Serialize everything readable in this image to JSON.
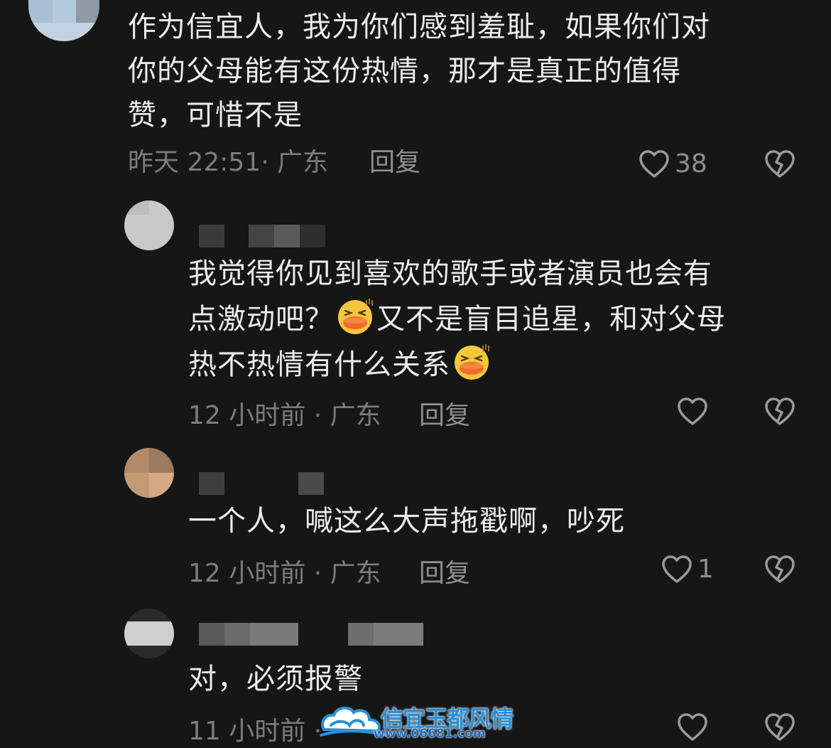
{
  "comments": [
    {
      "text": "作为信宜人，我为你们感到羞耻，如果你们对\n你的父母能有这份热情，那才是真正的值得\n赞，可惜不是",
      "time": "昨天 22:51·",
      "location": "广东",
      "reply_label": "回复",
      "likes": "38"
    },
    {
      "text_part1": "我觉得你见到喜欢的歌手或者演员也会有\n点激动吧？",
      "text_part2": "又不是盲目追星，和对父母\n热不热情有什么关系",
      "emoji": "duck-face-emoji",
      "time": "12 小时前 ·",
      "location": "广东",
      "reply_label": "回复",
      "likes": ""
    },
    {
      "text": "一个人，喊这么大声拖戳啊，吵死",
      "time": "12 小时前 ·",
      "location": "广东",
      "reply_label": "回复",
      "likes": "1"
    },
    {
      "text": "对，必须报警",
      "time": "11 小时前 ·",
      "location": "",
      "reply_label": "",
      "likes": ""
    }
  ],
  "watermark": {
    "title": "信宜玉都风情",
    "url": "www.06681.com"
  },
  "colors": {
    "background": "#161616",
    "text": "#ececec",
    "meta": "#7c7c7c",
    "icon": "#9a9a9a",
    "watermark": "#2a8fd8"
  }
}
